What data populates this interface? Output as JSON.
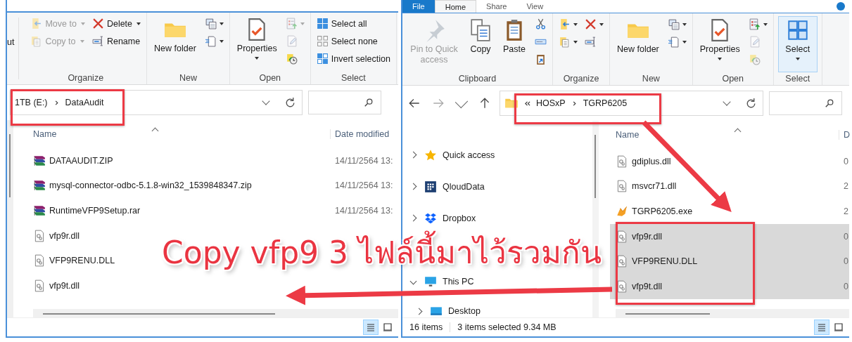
{
  "left_window": {
    "ribbon": {
      "cut_fragment": "ut",
      "groups": [
        {
          "label": "Organize",
          "columns": [
            [
              {
                "kind": "small",
                "label": "Move to",
                "disabled": true,
                "dropdown": true
              },
              {
                "kind": "small",
                "label": "Copy to",
                "disabled": true,
                "dropdown": true
              }
            ],
            [
              {
                "kind": "small",
                "label": "Delete",
                "disabled": false,
                "dropdown": true
              },
              {
                "kind": "small",
                "label": "Rename",
                "disabled": false,
                "dropdown": false
              }
            ]
          ]
        },
        {
          "label": "New",
          "columns": [
            [
              {
                "kind": "large",
                "label": "New folder",
                "disabled": false,
                "dropdown": false
              }
            ],
            [
              {
                "kind": "icon",
                "disabled": false,
                "dropdown": true
              },
              {
                "kind": "icon",
                "disabled": false,
                "dropdown": true
              }
            ]
          ]
        },
        {
          "label": "Open",
          "columns": [
            [
              {
                "kind": "large",
                "label": "Properties",
                "disabled": false,
                "dropdown": true
              }
            ],
            [
              {
                "kind": "icon",
                "disabled": true,
                "dropdown": true
              },
              {
                "kind": "icon",
                "disabled": true,
                "dropdown": false
              },
              {
                "kind": "icon",
                "disabled": false,
                "dropdown": false
              }
            ]
          ]
        },
        {
          "label": "Select",
          "columns": [
            [
              {
                "kind": "small",
                "label": "Select all",
                "disabled": false,
                "dropdown": false
              },
              {
                "kind": "small",
                "label": "Select none",
                "disabled": false,
                "dropdown": false
              },
              {
                "kind": "small",
                "label": "Invert selection",
                "disabled": false,
                "dropdown": false
              }
            ]
          ]
        }
      ]
    },
    "address": {
      "segments": [
        "1TB (E:)",
        "DataAudit"
      ]
    },
    "columns": [
      "Name",
      "Date modified"
    ],
    "files": [
      {
        "kind": "archive",
        "name": "DATAAUDIT.ZIP",
        "date": "14/11/2564 13:",
        "selected": false
      },
      {
        "kind": "archive",
        "name": "mysql-connector-odbc-5.1.8-win32_1539848347.zip",
        "date": "14/11/2564 13:",
        "selected": false
      },
      {
        "kind": "archive",
        "name": "RuntimeVFP9Setup.rar",
        "date": "14/11/2564 13:",
        "selected": false
      },
      {
        "kind": "library",
        "name": "vfp9r.dll",
        "selected": false
      },
      {
        "kind": "library",
        "name": "VFP9RENU.DLL",
        "selected": false
      },
      {
        "kind": "library",
        "name": "vfp9t.dll",
        "selected": false
      }
    ]
  },
  "right_window": {
    "tabs": [
      {
        "label": "File",
        "kind": "file",
        "selected": false
      },
      {
        "label": "Home",
        "kind": "tab",
        "selected": true
      },
      {
        "label": "Share",
        "kind": "tab",
        "selected": false
      },
      {
        "label": "View",
        "kind": "tab",
        "selected": false
      }
    ],
    "ribbon": {
      "groups": [
        {
          "label": "Clipboard",
          "columns": [
            [
              {
                "kind": "large",
                "label": "Pin to Quick access",
                "disabled": true,
                "dropdown": false
              }
            ],
            [
              {
                "kind": "large",
                "label": "Copy",
                "disabled": false,
                "dropdown": false
              }
            ],
            [
              {
                "kind": "large",
                "label": "Paste",
                "disabled": false,
                "dropdown": false
              }
            ],
            [
              {
                "kind": "icon",
                "disabled": false,
                "dropdown": false
              },
              {
                "kind": "icon",
                "disabled": false,
                "dropdown": false
              },
              {
                "kind": "icon",
                "disabled": false,
                "dropdown": false
              }
            ]
          ]
        },
        {
          "label": "Organize",
          "columns": [
            [
              {
                "kind": "icon",
                "disabled": false,
                "dropdown": true
              },
              {
                "kind": "icon",
                "disabled": false,
                "dropdown": true
              }
            ],
            [
              {
                "kind": "icon",
                "disabled": false,
                "dropdown": true
              },
              {
                "kind": "icon",
                "disabled": false,
                "dropdown": false
              }
            ]
          ]
        },
        {
          "label": "New",
          "columns": [
            [
              {
                "kind": "large",
                "label": "New folder",
                "disabled": false,
                "dropdown": false
              }
            ],
            [
              {
                "kind": "icon",
                "disabled": false,
                "dropdown": true
              },
              {
                "kind": "icon",
                "disabled": false,
                "dropdown": true
              }
            ]
          ]
        },
        {
          "label": "Open",
          "columns": [
            [
              {
                "kind": "large",
                "label": "Properties",
                "disabled": false,
                "dropdown": true
              }
            ],
            [
              {
                "kind": "icon",
                "disabled": false,
                "dropdown": true
              },
              {
                "kind": "icon",
                "disabled": true,
                "dropdown": false
              },
              {
                "kind": "icon",
                "disabled": true,
                "dropdown": false
              }
            ]
          ]
        },
        {
          "label": "Select",
          "columns": [
            [
              {
                "kind": "large",
                "label": "Select",
                "disabled": false,
                "dropdown": true,
                "highlighted": true
              }
            ]
          ]
        }
      ]
    },
    "address": {
      "segments": [
        "HOSxP",
        "TGRP6205"
      ]
    },
    "nav": [
      {
        "label": "Quick access",
        "expanded": false
      },
      {
        "label": "QloudData",
        "expanded": false
      },
      {
        "label": "Dropbox",
        "expanded": false
      },
      {
        "label": "This PC",
        "expanded": true,
        "children": [
          {
            "label": "Desktop",
            "expanded": false
          }
        ]
      }
    ],
    "columns": [
      "Name",
      "D"
    ],
    "files": [
      {
        "kind": "library",
        "name": "gdiplus.dll",
        "date": "0",
        "selected": false
      },
      {
        "kind": "library",
        "name": "msvcr71.dll",
        "date": "2",
        "selected": false
      },
      {
        "kind": "program",
        "name": "TGRP6205.exe",
        "date": "2",
        "selected": false
      },
      {
        "kind": "library",
        "name": "vfp9r.dll",
        "date": "0",
        "selected": true
      },
      {
        "kind": "library",
        "name": "VFP9RENU.DLL",
        "date": "0",
        "selected": true
      },
      {
        "kind": "library",
        "name": "vfp9t.dll",
        "date": "0",
        "selected": true
      }
    ],
    "status_bar": {
      "item_count": "16 items",
      "selection": "3 items selected  9.34 MB"
    }
  },
  "annotation": {
    "caption": "Copy vfp9 3 ไฟล์นี้มาไว้รวมกัน"
  }
}
